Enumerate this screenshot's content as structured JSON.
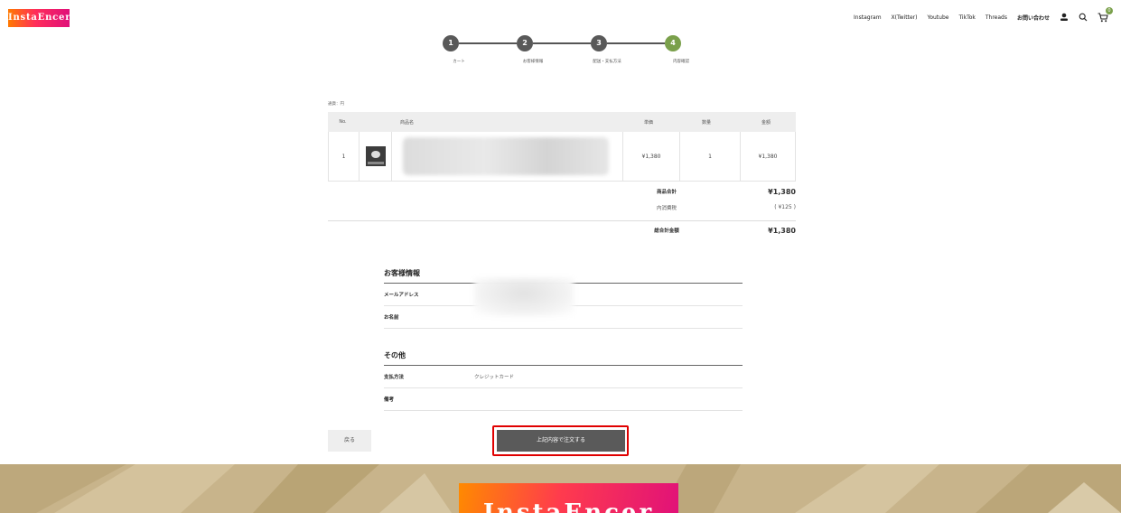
{
  "header": {
    "logo_text": "InstaEncer",
    "nav": [
      {
        "label": "Instagram",
        "bold": false
      },
      {
        "label": "X(Twitter)",
        "bold": false
      },
      {
        "label": "Youtube",
        "bold": false
      },
      {
        "label": "TikTok",
        "bold": false
      },
      {
        "label": "Threads",
        "bold": false
      },
      {
        "label": "お問い合わせ",
        "bold": true
      }
    ],
    "icons": [
      "user-icon",
      "search-icon",
      "cart-icon"
    ],
    "cart_count": "0"
  },
  "steps": [
    {
      "num": "1",
      "label": "カート",
      "active": false
    },
    {
      "num": "2",
      "label": "お客様情報",
      "active": false
    },
    {
      "num": "3",
      "label": "配送・支払方法",
      "active": false
    },
    {
      "num": "4",
      "label": "内容確認",
      "active": true
    }
  ],
  "currency_note": "通貨：円",
  "table": {
    "headers": {
      "no": "No.",
      "image": "",
      "name": "商品名",
      "unit_price": "単価",
      "quantity": "数量",
      "amount": "金額"
    },
    "rows": [
      {
        "no": "1",
        "unit_price": "¥1,380",
        "quantity": "1",
        "amount": "¥1,380"
      }
    ]
  },
  "summary": {
    "subtotal_label": "商品合計",
    "subtotal_value": "¥1,380",
    "tax_label": "内消費税",
    "tax_value": "( ¥125 )",
    "total_label": "総合計金額",
    "total_value": "¥1,380"
  },
  "customer": {
    "heading": "お客様情報",
    "email_label": "メールアドレス",
    "name_label": "お名前"
  },
  "other": {
    "heading": "その他",
    "payment_label": "支払方法",
    "payment_value": "クレジットカード",
    "notes_label": "備考"
  },
  "buttons": {
    "back": "戻る",
    "place_order": "上記内容で注文する"
  },
  "footer": {
    "logo_text": "InstaEncer"
  },
  "colors": {
    "accent_green": "#7aa04b",
    "step_gray": "#595959",
    "highlight_red": "#e00000",
    "footer_gold": "#c8b48b"
  }
}
